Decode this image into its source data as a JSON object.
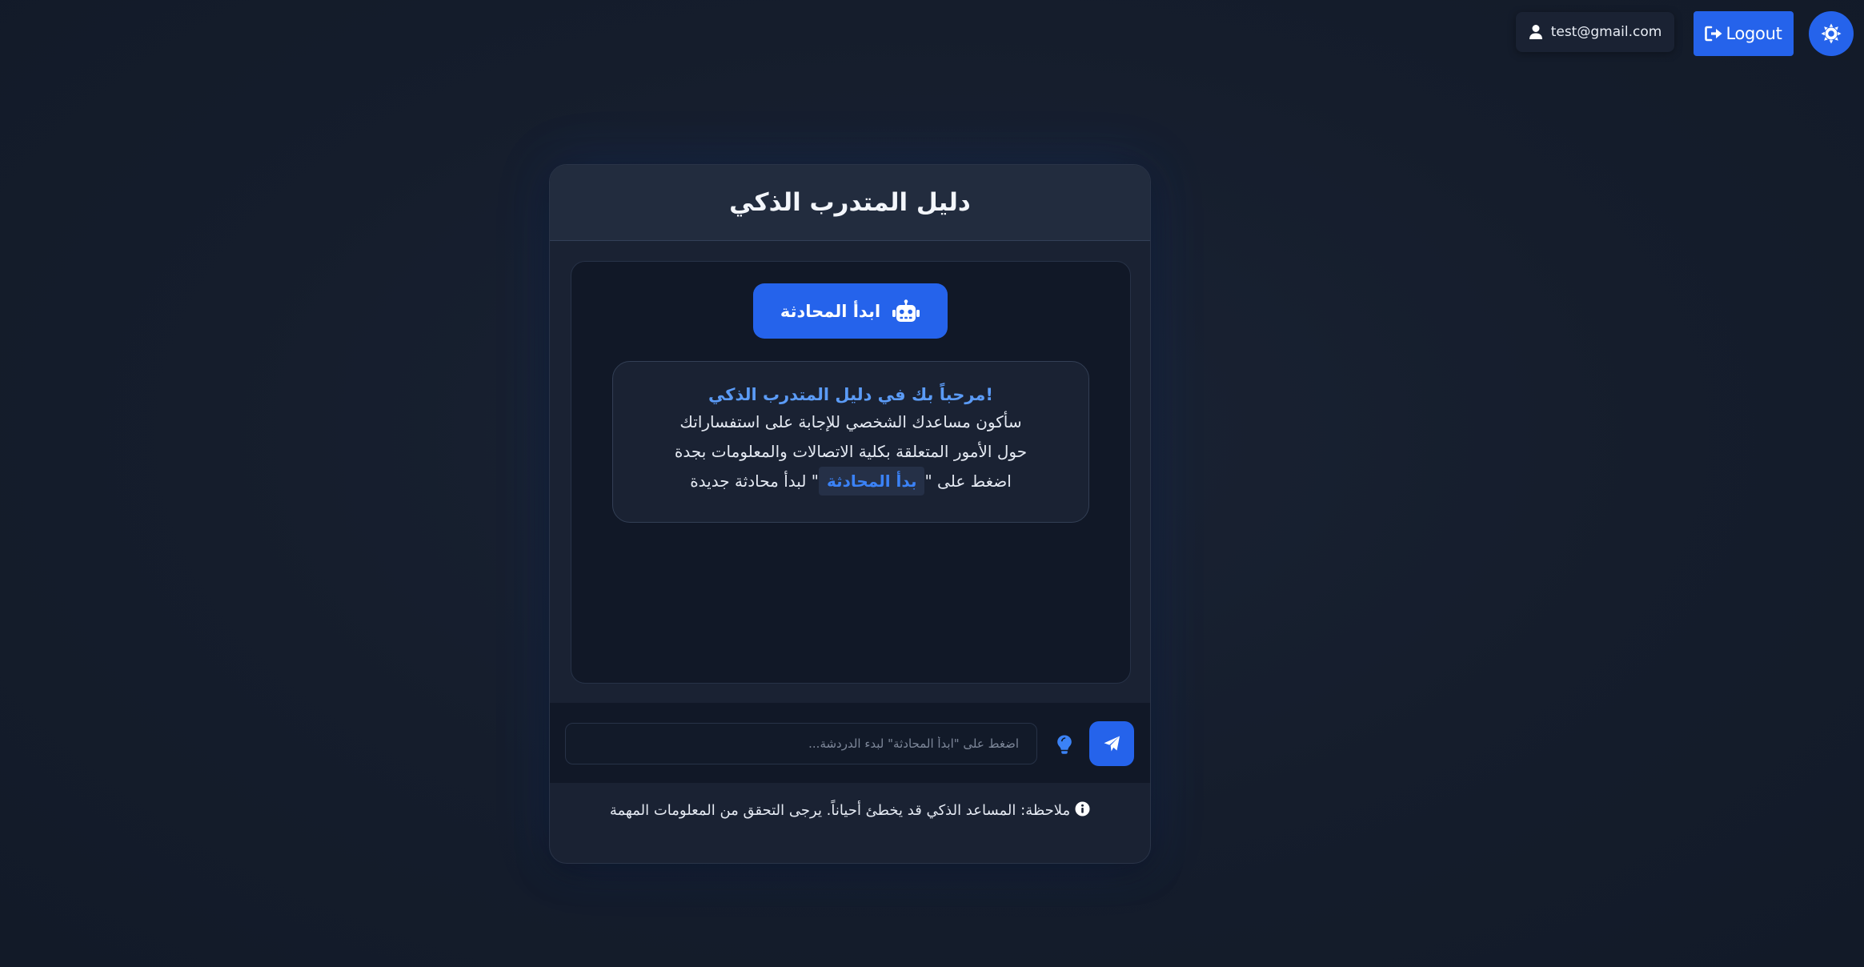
{
  "topbar": {
    "user_email": "test@gmail.com",
    "logout_label": "Logout"
  },
  "card": {
    "title": "دليل المتدرب الذكي",
    "start_button_label": "ابدأ المحادثة",
    "welcome": {
      "title": "!مرحباً بك في دليل المتدرب الذكي",
      "line1": "سأكون مساعدك الشخصي للإجابة على استفساراتك",
      "line2": "حول الأمور المتعلقة بكلية الاتصالات والمعلومات بجدة",
      "line3_prefix": "اضغط على \"",
      "line3_highlight": "بدأ المحادثة",
      "line3_suffix": "\" لبدأ محادثة جديدة"
    },
    "input_placeholder": "اضغط على \"ابدأ المحادثة\" لبدء الدردشة...",
    "note": "ملاحظة: المساعد الذكي قد يخطئ أحياناً. يرجى التحقق من المعلومات المهمة"
  },
  "colors": {
    "accent": "#2563eb",
    "highlight_text": "#5b9bf6",
    "background": "#151d2c",
    "card": "#1a2233",
    "chat_area": "#111827"
  },
  "icons": {
    "user": "user-icon",
    "logout": "logout-icon",
    "theme": "sun-icon",
    "robot": "robot-icon",
    "send": "send-icon",
    "hint": "lightbulb-icon",
    "info": "info-icon"
  }
}
